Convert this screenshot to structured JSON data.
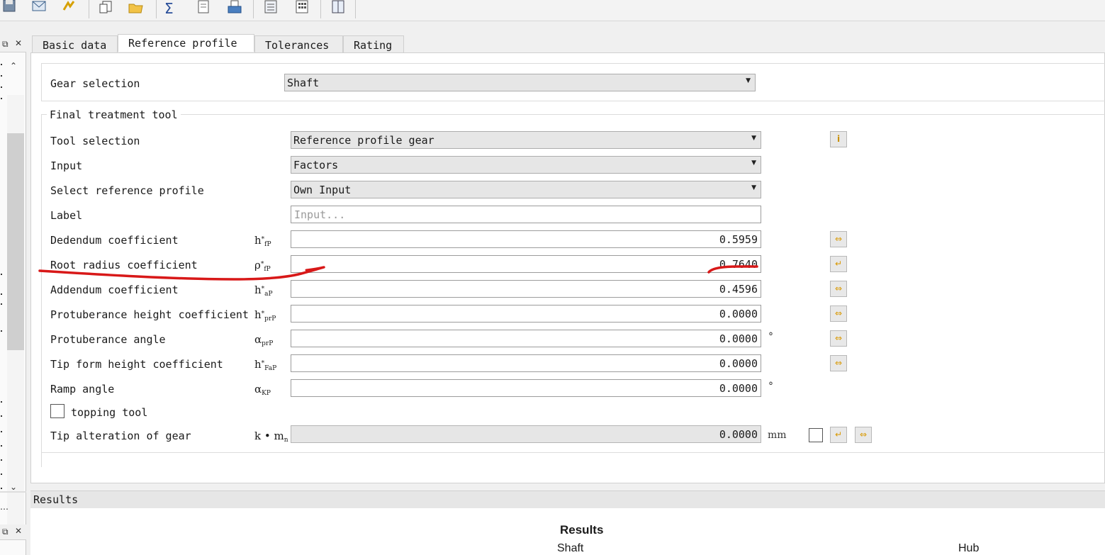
{
  "toolbar": {
    "icons": [
      "save-icon",
      "email-icon",
      "arrow-icon",
      "copy-icon",
      "open-folder-icon",
      "sum-icon",
      "document-icon",
      "print-icon",
      "report-icon",
      "calculator-icon",
      "book-icon"
    ],
    "sum_symbol": "Σ"
  },
  "tabs": {
    "basic": "Basic data",
    "reference": "Reference profile",
    "tolerances": "Tolerances",
    "rating": "Rating"
  },
  "gear_selection": {
    "label": "Gear selection",
    "value": "Shaft"
  },
  "group": {
    "title": "Final treatment tool"
  },
  "rows": {
    "tool_selection": {
      "label": "Tool selection",
      "value": "Reference profile gear"
    },
    "input": {
      "label": "Input",
      "value": "Factors"
    },
    "select_profile": {
      "label": "Select reference profile",
      "value": "Own Input"
    },
    "label_field": {
      "label": "Label",
      "placeholder": "Input..."
    },
    "dedendum": {
      "label": "Dedendum coefficient",
      "sym": "h",
      "sup": "*",
      "sub": "fP",
      "value": "0.5959"
    },
    "root_radius": {
      "label": "Root radius coefficient",
      "sym": "ρ",
      "sup": "*",
      "sub": "fP",
      "value": "0.7640"
    },
    "addendum": {
      "label": "Addendum coefficient",
      "sym": "h",
      "sup": "*",
      "sub": "aP",
      "value": "0.4596"
    },
    "prot_height": {
      "label": "Protuberance height coefficient",
      "sym": "h",
      "sup": "*",
      "sub": "prP",
      "value": "0.0000"
    },
    "prot_angle": {
      "label": "Protuberance angle",
      "sym": "α",
      "sub": "prP",
      "value": "0.0000",
      "unit": "°"
    },
    "tip_form": {
      "label": "Tip form height coefficient",
      "sym": "h",
      "sup": "*",
      "sub": "FaP",
      "value": "0.0000"
    },
    "ramp_angle": {
      "label": "Ramp angle",
      "sym": "α",
      "sub": "KP",
      "value": "0.0000",
      "unit": "°"
    },
    "topping": {
      "label": "topping tool"
    },
    "tip_alteration": {
      "label": "Tip alteration of gear",
      "sym": "k • m",
      "sub": "n",
      "value": "0.0000",
      "unit": "mm"
    }
  },
  "info_symbol": "i",
  "results": {
    "bar_label": "Results",
    "title": "Results",
    "col_shaft": "Shaft",
    "col_hub": "Hub"
  },
  "colors": {
    "accent_button": "#d99800",
    "annotation": "#d81818"
  }
}
